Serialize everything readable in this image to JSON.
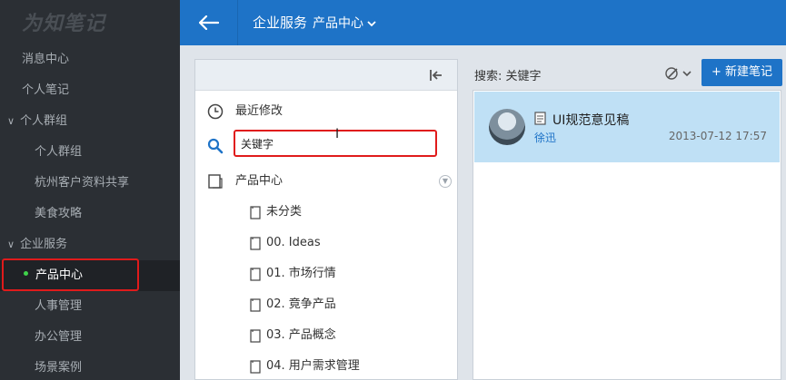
{
  "app": {
    "logo": "为知笔记"
  },
  "sidebar": {
    "items": [
      {
        "label": "消息中心"
      },
      {
        "label": "个人笔记"
      },
      {
        "label": "个人群组"
      },
      {
        "label": "个人群组"
      },
      {
        "label": "杭州客户资料共享"
      },
      {
        "label": "美食攻略"
      },
      {
        "label": "企业服务"
      },
      {
        "label": "产品中心"
      },
      {
        "label": "人事管理"
      },
      {
        "label": "办公管理"
      },
      {
        "label": "场景案例"
      }
    ]
  },
  "topbar": {
    "group": "企业服务",
    "folder": "产品中心"
  },
  "folder_panel": {
    "recent_label": "最近修改",
    "search_value": "关键字",
    "root_folder": "产品中心",
    "subfolders": [
      {
        "label": "未分类"
      },
      {
        "label": "00. Ideas"
      },
      {
        "label": "01. 市场行情"
      },
      {
        "label": "02. 竟争产品"
      },
      {
        "label": "03. 产品概念"
      },
      {
        "label": "04. 用户需求管理"
      }
    ]
  },
  "notes_panel": {
    "search_label": "搜索: 关键字",
    "new_note_label": "+ 新建笔记",
    "notes": [
      {
        "title": "UI规范意见稿",
        "author": "徐迅",
        "time": "2013-07-12 17:57"
      }
    ]
  },
  "colors": {
    "accent": "#1e73c7",
    "sidebar_bg": "#2b2f34",
    "highlight": "#e01b1b",
    "selected_note": "#bfe0f5"
  }
}
